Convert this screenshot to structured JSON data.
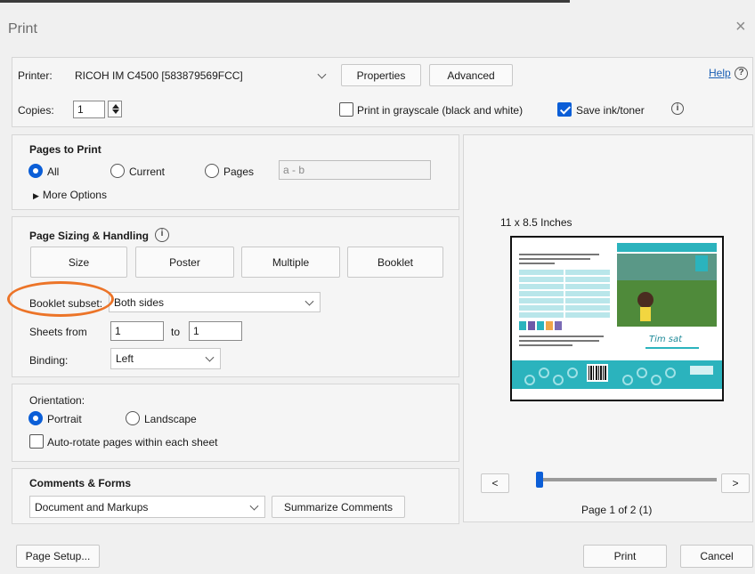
{
  "window": {
    "title": "Print",
    "close_glyph": "×"
  },
  "header": {
    "printer_label": "Printer:",
    "printer_value": "RICOH IM C4500 [583879569FCC]",
    "properties_label": "Properties",
    "advanced_label": "Advanced",
    "help_label": "Help",
    "help_icon": "?",
    "copies_label": "Copies:",
    "copies_value": "1",
    "grayscale_label": "Print in grayscale (black and white)",
    "grayscale_checked": false,
    "save_ink_label": "Save ink/toner",
    "save_ink_checked": true,
    "info_icon": "i"
  },
  "pages_to_print": {
    "heading": "Pages to Print",
    "all_label": "All",
    "current_label": "Current",
    "pages_label": "Pages",
    "selected": "All",
    "pages_placeholder": "a - b",
    "more_options_label": "More Options",
    "more_options_glyph": "▶"
  },
  "page_sizing": {
    "heading": "Page Sizing & Handling",
    "info_icon": "i",
    "buttons": [
      "Size",
      "Poster",
      "Multiple",
      "Booklet"
    ],
    "booklet_subset_label": "Booklet subset:",
    "booklet_subset_value": "Both sides",
    "sheets_from_label": "Sheets from",
    "sheets_from_value": "1",
    "to_label": "to",
    "to_value": "1",
    "binding_label": "Binding:",
    "binding_value": "Left"
  },
  "orientation": {
    "heading": "Orientation:",
    "portrait_label": "Portrait",
    "landscape_label": "Landscape",
    "selected": "Portrait",
    "auto_rotate_label": "Auto-rotate pages within each sheet",
    "auto_rotate_checked": false
  },
  "comments_forms": {
    "heading": "Comments & Forms",
    "value": "Document and Markups",
    "summarize_label": "Summarize Comments"
  },
  "preview": {
    "size_label": "11 x 8.5 Inches",
    "book_title": "Tim sat",
    "page_text": "Page 1 of 2 (1)",
    "prev_glyph": "<",
    "next_glyph": ">",
    "position_fraction": 0.0
  },
  "footer": {
    "page_setup_label": "Page Setup...",
    "print_label": "Print",
    "cancel_label": "Cancel"
  },
  "colors": {
    "accent": "#0b5ed7",
    "highlight_oval": "#ec7428",
    "link": "#1a5fb4",
    "teal": "#2bb3bd"
  }
}
